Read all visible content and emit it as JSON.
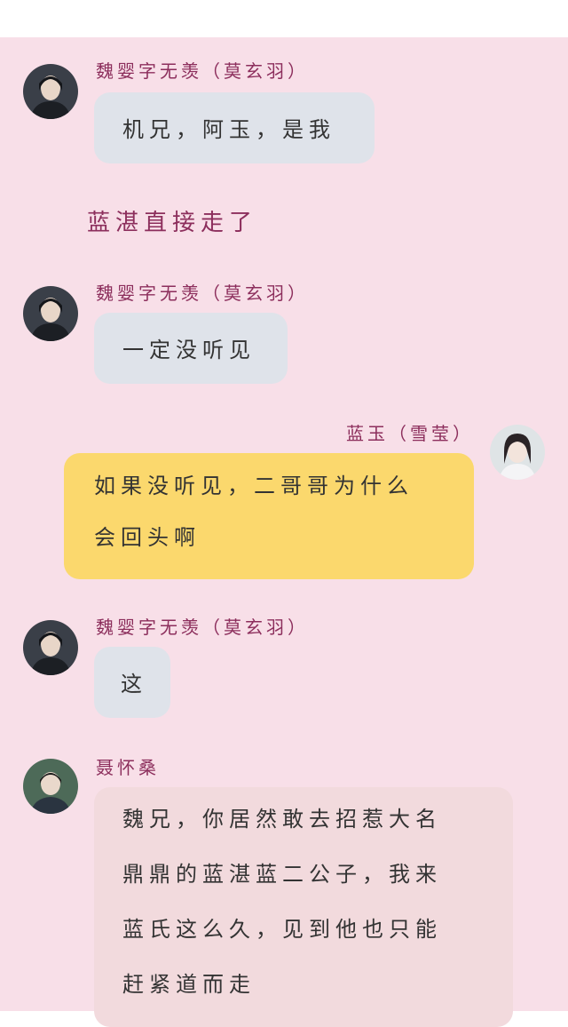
{
  "messages": [
    {
      "sender": "魏婴字无羡（莫玄羽）",
      "text": "机兄，阿玉，是我",
      "side": "left"
    },
    {
      "narration": "蓝湛直接走了"
    },
    {
      "sender": "魏婴字无羡（莫玄羽）",
      "text": "一定没听见",
      "side": "left"
    },
    {
      "sender": "蓝玉（雪莹）",
      "lines": [
        "如果没听见，二哥哥为什么",
        "会回头啊"
      ],
      "side": "right"
    },
    {
      "sender": "魏婴字无羡（莫玄羽）",
      "text": "这",
      "side": "left"
    },
    {
      "sender": "聂怀桑",
      "lines": [
        "魏兄，你居然敢去招惹大名",
        "鼎鼎的蓝湛蓝二公子，我来",
        "蓝氏这么久，见到他也只能",
        "赶紧道而走"
      ],
      "side": "left"
    }
  ],
  "colors": {
    "chat_background": "#f8dfe8",
    "name_color": "#8c2e5c",
    "left_bubble": "#dfe3ea",
    "right_bubble": "#fbd86d",
    "nie_bubble": "#f2dadd"
  }
}
